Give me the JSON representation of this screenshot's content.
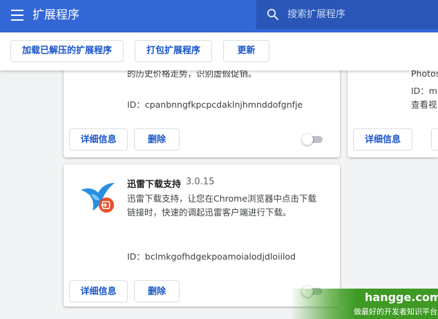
{
  "header": {
    "title": "扩展程序",
    "search_placeholder": "搜索扩展程序"
  },
  "toolbar": {
    "load_unpacked": "加载已解压的扩展程序",
    "pack": "打包扩展程序",
    "update": "更新"
  },
  "cards": [
    {
      "description_tail": "的历史价格走势，识别虚假促销。",
      "id_text": "ID：cpanbnngfkpcpcdaklnjhmnddofgnfje",
      "details_label": "详细信息",
      "remove_label": "删除",
      "enabled": false
    },
    {
      "description_line1": "Photos",
      "description_line2": "ID：me",
      "description_line3": "查看视",
      "details_label": "详细信息",
      "enabled": false
    },
    {
      "name": "迅雷下载支持",
      "version": "3.0.15",
      "description_line1": "迅雷下载支持，让您在Chrome浏览器中点击下载",
      "description_line2": "链接时，快速的调起迅雷客户端进行下载。",
      "id_text": "ID：bclmkgofhdgekpoamoialodjdloiilod",
      "details_label": "详细信息",
      "remove_label": "删除",
      "enabled": false
    }
  ],
  "watermark": {
    "domain": "hangge.com",
    "slogan": "做最好的开发者知识平台"
  },
  "colors": {
    "header_bg": "#3367d6",
    "search_bg": "#2a56b7",
    "button_text": "#1a55c9",
    "page_bg": "#f1f3f4",
    "toggle_off": "#bdc1c6"
  }
}
